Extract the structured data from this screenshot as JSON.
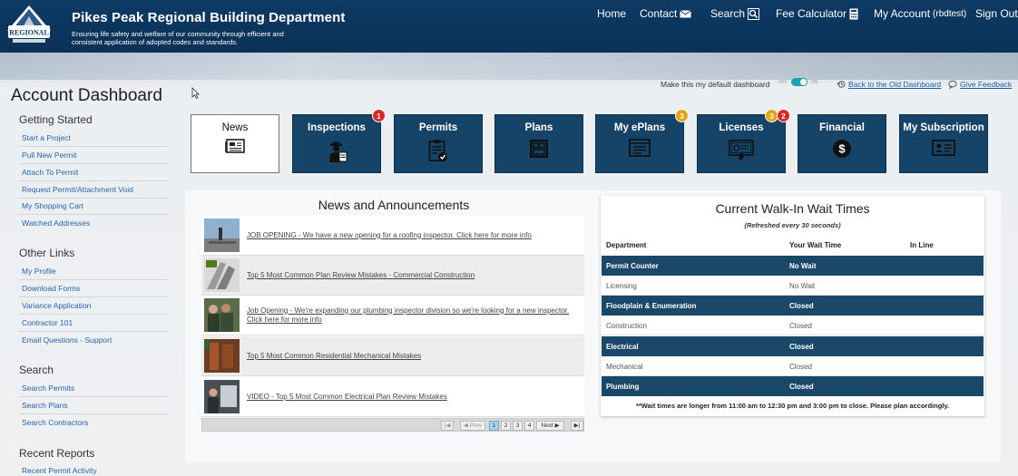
{
  "header": {
    "title": "Pikes Peak Regional Building Department",
    "tagline": "Ensuring life safety and welfare of our community through efficient and consistent application of adopted codes and standards.",
    "nav": {
      "home": "Home",
      "contact": "Contact",
      "search": "Search",
      "fee_calculator": "Fee Calculator",
      "my_account": "My Account",
      "username": "(rbdtest)",
      "sign_out": "Sign Out"
    },
    "logo_text": "REGIONAL"
  },
  "sidebar": {
    "page_title": "Account Dashboard",
    "sections": [
      {
        "title": "Getting Started",
        "items": [
          "Start a Project",
          "Pull New Permit",
          "Attach To Permit",
          "Request Permit/Attachment Void",
          "My Shopping Cart",
          "Watched Addresses"
        ]
      },
      {
        "title": "Other Links",
        "items": [
          "My Profile",
          "Download Forms",
          "Variance Application",
          "Contractor 101",
          "Email Questions - Support"
        ]
      },
      {
        "title": "Search",
        "items": [
          "Search Permits",
          "Search Plans",
          "Search Contractors"
        ]
      },
      {
        "title": "Recent Reports",
        "items": [
          "Recent Permit Activity"
        ]
      }
    ]
  },
  "toolbar": {
    "default_label": "Make this my default dashboard",
    "toggle_off": "OFF",
    "toggle_on": "ON",
    "toggle_state": true,
    "back_link": "Back to the Old Dashboard",
    "feedback_link": "Give Feedback"
  },
  "tiles": [
    {
      "label": "News",
      "icon": "newspaper-icon",
      "active": true
    },
    {
      "label": "Inspections",
      "icon": "inspector-icon",
      "badges": [
        {
          "value": "1",
          "color": "red"
        }
      ]
    },
    {
      "label": "Permits",
      "icon": "clipboard-check-icon"
    },
    {
      "label": "Plans",
      "icon": "blueprint-icon"
    },
    {
      "label": "My ePlans",
      "icon": "monitor-icon",
      "badges": [
        {
          "value": "3",
          "color": "gold"
        }
      ]
    },
    {
      "label": "Licenses",
      "icon": "certificate-icon",
      "badges": [
        {
          "value": "3",
          "color": "gold"
        },
        {
          "value": "2",
          "color": "red"
        }
      ]
    },
    {
      "label": "Financial",
      "icon": "dollar-icon"
    },
    {
      "label": "My Subscription",
      "icon": "id-card-icon"
    }
  ],
  "news": {
    "title": "News and Announcements",
    "items": [
      "JOB OPENING - We have a new opening for a roofing inspector. Click here for more info",
      "Top 5 Most Common Plan Review Mistakes - Commercial Construction",
      "Job Opening - We're expanding our plumbing inspector division so we're looking for a new inspector. Click here for more info",
      "Top 5 Most Common Residential Mechanical Mistakes",
      "VIDEO - Top 5 Most Common Electrical Plan Review Mistakes"
    ],
    "pager": {
      "prev": "Prev",
      "next": "Next",
      "pages": [
        "1",
        "2",
        "3",
        "4"
      ],
      "current": "1"
    }
  },
  "wait_times": {
    "title": "Current Walk-In Wait Times",
    "subtitle": "(Refreshed every 30 seconds)",
    "columns": [
      "Department",
      "Your Wait Time",
      "In Line"
    ],
    "rows": [
      {
        "department": "Permit Counter",
        "wait": "No Wait",
        "in_line": "",
        "style": "dark"
      },
      {
        "department": "Licensing",
        "wait": "No Wait",
        "in_line": "",
        "style": "light"
      },
      {
        "department": "Floodplain & Enumeration",
        "wait": "Closed",
        "in_line": "",
        "style": "dark"
      },
      {
        "department": "Construction",
        "wait": "Closed",
        "in_line": "",
        "style": "light"
      },
      {
        "department": "Electrical",
        "wait": "Closed",
        "in_line": "",
        "style": "dark"
      },
      {
        "department": "Mechanical",
        "wait": "Closed",
        "in_line": "",
        "style": "light"
      },
      {
        "department": "Plumbing",
        "wait": "Closed",
        "in_line": "",
        "style": "dark"
      }
    ],
    "note": "**Wait times are longer from 11:00 am to 12:30 pm and 3:00 pm to close. Please plan accordingly."
  },
  "colors": {
    "navy": "#0e3a64",
    "tile": "#154468",
    "row_dark": "#1b4869",
    "link": "#2a64a8",
    "badge_red": "#d42a2a",
    "badge_gold": "#e0a514",
    "toggle": "#1aa3b5"
  }
}
